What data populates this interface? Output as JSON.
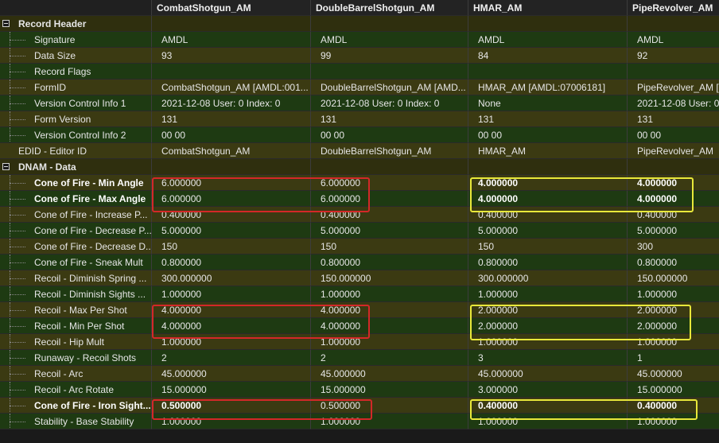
{
  "columns": [
    "",
    "CombatShotgun_AM",
    "DoubleBarrelShotgun_AM",
    "HMAR_AM",
    "PipeRevolver_AM"
  ],
  "rows": [
    {
      "label": "Record Header",
      "kind": "section-top",
      "values": [
        "",
        "",
        "",
        ""
      ]
    },
    {
      "label": "Signature",
      "kind": "child",
      "values": [
        "AMDL",
        "AMDL",
        "AMDL",
        "AMDL"
      ]
    },
    {
      "label": "Data Size",
      "kind": "child",
      "values": [
        "93",
        "99",
        "84",
        "92"
      ]
    },
    {
      "label": "Record Flags",
      "kind": "child",
      "values": [
        "",
        "",
        "",
        ""
      ]
    },
    {
      "label": "FormID",
      "kind": "child",
      "values": [
        "CombatShotgun_AM [AMDL:001...",
        "DoubleBarrelShotgun_AM [AMD...",
        "HMAR_AM [AMDL:07006181]",
        "PipeRevolver_AM ["
      ]
    },
    {
      "label": "Version Control Info 1",
      "kind": "child",
      "values": [
        "2021-12-08 User: 0 Index: 0",
        "2021-12-08 User: 0 Index: 0",
        "None",
        "2021-12-08 User: 0"
      ]
    },
    {
      "label": "Form Version",
      "kind": "child",
      "values": [
        "131",
        "131",
        "131",
        "131"
      ]
    },
    {
      "label": "Version Control Info 2",
      "kind": "child",
      "values": [
        "00 00",
        "00 00",
        "00 00",
        "00 00"
      ]
    },
    {
      "label": "EDID - Editor ID",
      "kind": "top",
      "values": [
        "CombatShotgun_AM",
        "DoubleBarrelShotgun_AM",
        "HMAR_AM",
        "PipeRevolver_AM"
      ]
    },
    {
      "label": "DNAM - Data",
      "kind": "section",
      "values": [
        "",
        "",
        "",
        ""
      ]
    },
    {
      "label": "Cone of Fire - Min Angle",
      "kind": "child",
      "bold": true,
      "values": [
        "6.000000",
        "6.000000",
        "4.000000",
        "4.000000"
      ],
      "boldcols": [
        2,
        3
      ]
    },
    {
      "label": "Cone of Fire - Max Angle",
      "kind": "child",
      "bold": true,
      "values": [
        "6.000000",
        "6.000000",
        "4.000000",
        "4.000000"
      ],
      "boldcols": [
        2,
        3
      ]
    },
    {
      "label": "Cone of Fire - Increase P...",
      "kind": "child",
      "values": [
        "0.400000",
        "0.400000",
        "0.400000",
        "0.400000"
      ]
    },
    {
      "label": "Cone of Fire - Decrease P...",
      "kind": "child",
      "values": [
        "5.000000",
        "5.000000",
        "5.000000",
        "5.000000"
      ]
    },
    {
      "label": "Cone of Fire - Decrease D...",
      "kind": "child",
      "values": [
        "150",
        "150",
        "150",
        "300"
      ]
    },
    {
      "label": "Cone of Fire - Sneak Mult",
      "kind": "child",
      "values": [
        "0.800000",
        "0.800000",
        "0.800000",
        "0.800000"
      ]
    },
    {
      "label": "Recoil - Diminish Spring ...",
      "kind": "child",
      "values": [
        "300.000000",
        "150.000000",
        "300.000000",
        "150.000000"
      ]
    },
    {
      "label": "Recoil - Diminish Sights ...",
      "kind": "child",
      "values": [
        "1.000000",
        "1.000000",
        "1.000000",
        "1.000000"
      ]
    },
    {
      "label": "Recoil - Max Per Shot",
      "kind": "child",
      "values": [
        "4.000000",
        "4.000000",
        "2.000000",
        "2.000000"
      ]
    },
    {
      "label": "Recoil - Min Per Shot",
      "kind": "child",
      "values": [
        "4.000000",
        "4.000000",
        "2.000000",
        "2.000000"
      ]
    },
    {
      "label": "Recoil - Hip Mult",
      "kind": "child",
      "values": [
        "1.000000",
        "1.000000",
        "1.000000",
        "1.000000"
      ]
    },
    {
      "label": "Runaway - Recoil Shots",
      "kind": "child",
      "values": [
        "2",
        "2",
        "3",
        "1"
      ]
    },
    {
      "label": "Recoil - Arc",
      "kind": "child",
      "values": [
        "45.000000",
        "45.000000",
        "45.000000",
        "45.000000"
      ]
    },
    {
      "label": "Recoil - Arc Rotate",
      "kind": "child",
      "values": [
        "15.000000",
        "15.000000",
        "3.000000",
        "15.000000"
      ]
    },
    {
      "label": "Cone of Fire - Iron Sight...",
      "kind": "child",
      "bold": true,
      "values": [
        "0.500000",
        "0.500000",
        "0.400000",
        "0.400000"
      ],
      "boldcols": [
        0,
        2,
        3
      ]
    },
    {
      "label": "Stability - Base Stability",
      "kind": "child",
      "values": [
        "1.000000",
        "1.000000",
        "1.000000",
        "1.000000"
      ]
    }
  ]
}
